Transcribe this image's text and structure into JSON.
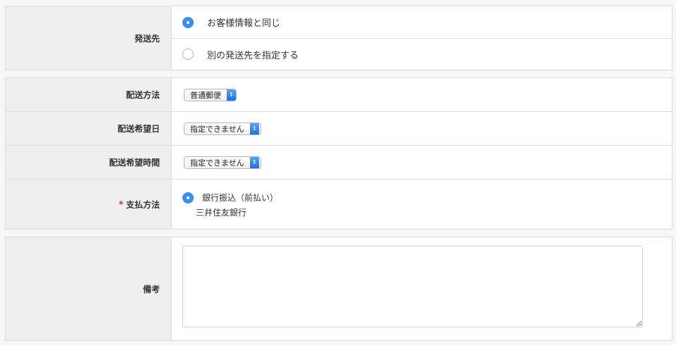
{
  "shipping_destination": {
    "label": "発送先",
    "options": [
      {
        "label": "お客様情報と同じ",
        "selected": true
      },
      {
        "label": "別の発送先を指定する",
        "selected": false
      }
    ]
  },
  "delivery": {
    "method": {
      "label": "配送方法",
      "value": "普通郵便"
    },
    "date": {
      "label": "配送希望日",
      "value": "指定できません"
    },
    "time": {
      "label": "配送希望時間",
      "value": "指定できません"
    },
    "payment": {
      "label": "支払方法",
      "required_mark": "*",
      "option_label": "銀行振込（前払い）",
      "option_detail": "三井住友銀行",
      "selected": true
    }
  },
  "remarks": {
    "label": "備考",
    "value": ""
  },
  "colors": {
    "accent": "#3b8eea",
    "required": "#e0223c"
  }
}
